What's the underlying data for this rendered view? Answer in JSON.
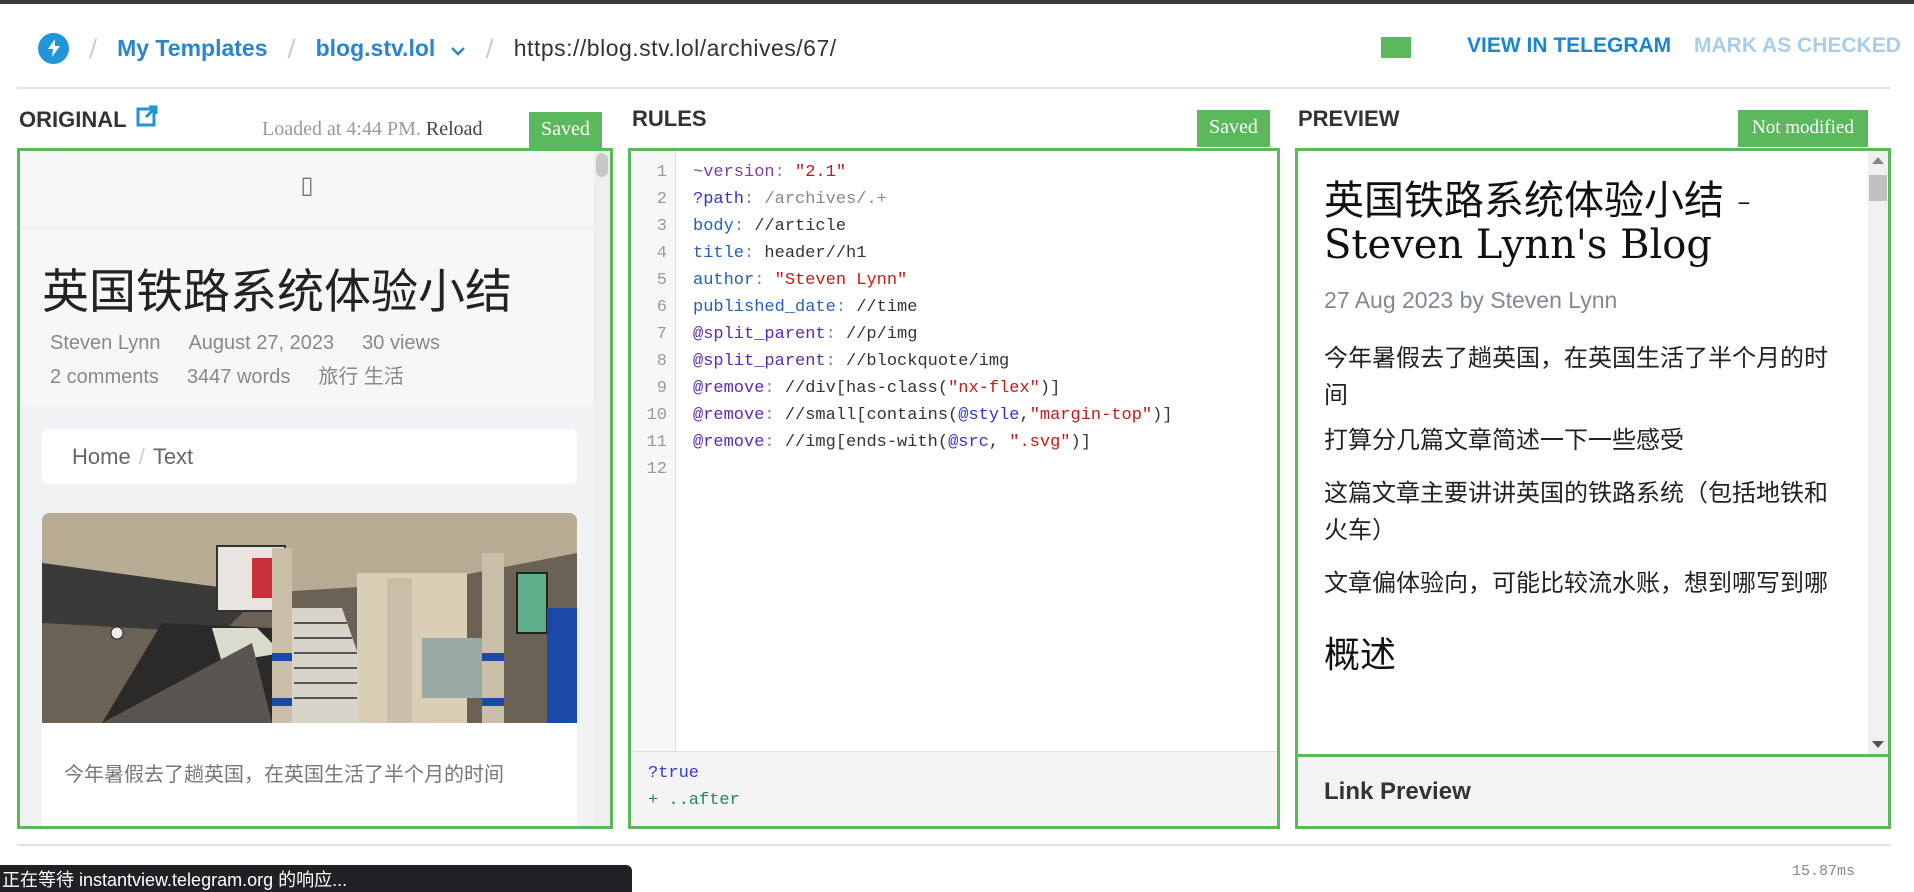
{
  "header": {
    "breadcrumb": [
      {
        "label": "My Templates"
      },
      {
        "label": "blog.stv.lol"
      }
    ],
    "url": "https://blog.stv.lol/archives/67/",
    "status_color": "#5cb85c",
    "view_in_telegram": "VIEW IN TELEGRAM",
    "mark_as_checked": "MARK AS CHECKED"
  },
  "original": {
    "title": "ORIGINAL",
    "loaded_text": "Loaded at 4:44 PM.",
    "reload_label": "Reload",
    "badge": "Saved",
    "menu_glyph": "▯",
    "page": {
      "h1": "英国铁路系统体验小结",
      "meta_line1": [
        "Steven Lynn",
        "August 27, 2023",
        "30 views"
      ],
      "meta_line2": [
        "2 comments",
        "3447 words",
        "旅行 生活"
      ],
      "breadcrumb_home": "Home",
      "breadcrumb_sep": "/",
      "breadcrumb_current": "Text",
      "excerpt": "今年暑假去了趟英国，在英国生活了半个月的时间"
    }
  },
  "rules": {
    "title": "RULES",
    "badge": "Saved",
    "lines": [
      {
        "n": "1",
        "key": "~version",
        "sep": ": ",
        "val": "\"2.1\""
      },
      {
        "n": "2",
        "key": "?path",
        "sep": ": ",
        "val": "/archives/.+"
      },
      {
        "n": "3",
        "key": "body",
        "sep": ": ",
        "val": "//article"
      },
      {
        "n": "4",
        "key": "title",
        "sep": ": ",
        "val": "header//h1"
      },
      {
        "n": "5",
        "key": "author",
        "sep": ": ",
        "val": "\"Steven Lynn\""
      },
      {
        "n": "6",
        "key": "published_date",
        "sep": ": ",
        "val": "//time"
      },
      {
        "n": "7",
        "key": "@split_parent",
        "sep": ": ",
        "val": "//p/img"
      },
      {
        "n": "8",
        "key": "@split_parent",
        "sep": ": ",
        "val": "//blockquote/img"
      },
      {
        "n": "9",
        "key": "@remove",
        "sep": ": ",
        "val_a": "//div[has-class(",
        "val_str": "\"nx-flex\"",
        "val_b": ")]"
      },
      {
        "n": "10",
        "key": "@remove",
        "sep": ": ",
        "val_a": "//small[contains(",
        "val_attr": "@style",
        "val_mid": ",",
        "val_str": "\"margin-top\"",
        "val_b": ")]"
      },
      {
        "n": "11",
        "key": "@remove",
        "sep": ": ",
        "val_a": "//img[ends-with(",
        "val_attr": "@src",
        "val_mid": ", ",
        "val_str": "\".svg\"",
        "val_b": ")]"
      },
      {
        "n": "12"
      }
    ],
    "footer": [
      "?true",
      "+ ..after"
    ]
  },
  "preview": {
    "title": "PREVIEW",
    "badge": "Not modified",
    "h1_line1": "英国铁路系统体验小结 -",
    "h1_line2": "Steven Lynn's Blog",
    "subtitle": "27 Aug 2023 by Steven Lynn",
    "paragraphs": [
      "今年暑假去了趟英国，在英国生活了半个月的时间",
      "打算分几篇文章简述一下一些感受",
      "这篇文章主要讲讲英国的铁路系统（包括地铁和火车）",
      "文章偏体验向，可能比较流水账，想到哪写到哪"
    ],
    "h2": "概述",
    "link_preview": "Link Preview"
  },
  "footer": {
    "timing": "15.87ms",
    "browser_status": "正在等待 instantview.telegram.org 的响应..."
  }
}
